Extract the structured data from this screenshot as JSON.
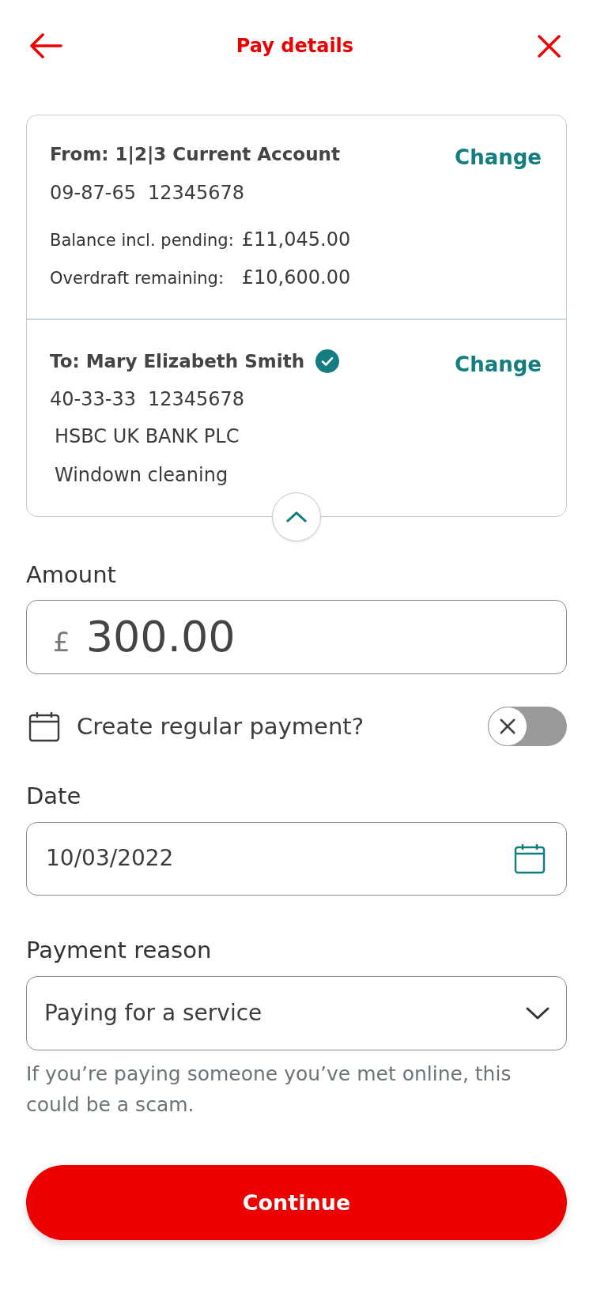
{
  "header": {
    "title": "Pay details"
  },
  "from": {
    "title": "From: 1|2|3 Current Account",
    "sort_code": "09-87-65",
    "account_number": "12345678",
    "change_label": "Change",
    "balances": [
      {
        "label": "Balance incl. pending:",
        "value": "£11,045.00"
      },
      {
        "label": "Overdraft remaining:",
        "value": "£10,600.00"
      }
    ]
  },
  "to": {
    "title": "To: Mary Elizabeth Smith",
    "verified": true,
    "sort_code": "40-33-33",
    "account_number": "12345678",
    "change_label": "Change",
    "lines": [
      "HSBC UK BANK PLC",
      "Windown cleaning"
    ]
  },
  "details_expanded": true,
  "amount": {
    "label": "Amount",
    "currency": "£",
    "value": "300.00"
  },
  "regular_payment": {
    "label": "Create regular payment?",
    "on": false
  },
  "date": {
    "label": "Date",
    "value": "10/03/2022"
  },
  "payment_reason": {
    "label": "Payment reason",
    "value": "Paying for a service",
    "hint": "If you’re paying someone you’ve met online, this could be a scam."
  },
  "continue_button": "Continue"
}
